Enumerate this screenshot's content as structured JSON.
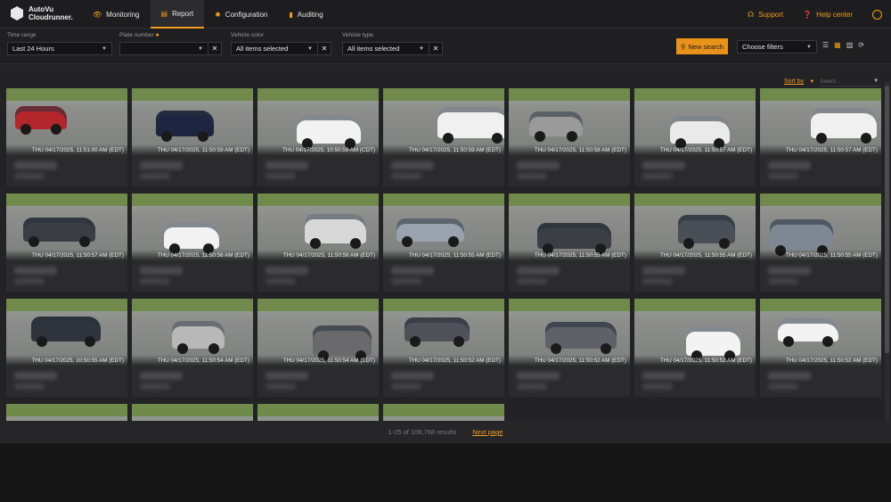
{
  "app": {
    "logo_line1": "AutoVu",
    "logo_line2": "Cloudrunner."
  },
  "nav": {
    "items": [
      {
        "label": "Monitoring",
        "icon": "binoculars-icon",
        "glyph": "👁"
      },
      {
        "label": "Report",
        "icon": "report-icon",
        "glyph": "▤",
        "active": true
      },
      {
        "label": "Configuration",
        "icon": "gear-icon",
        "glyph": "✹"
      },
      {
        "label": "Auditing",
        "icon": "document-icon",
        "glyph": "▮"
      }
    ],
    "support": "Support",
    "help": "Help center"
  },
  "filters": {
    "time_range": {
      "label": "Time range",
      "value": "Last 24 Hours"
    },
    "plate_number": {
      "label": "Plate number",
      "value": ""
    },
    "vehicle_color": {
      "label": "Vehicle color",
      "value": "All items selected"
    },
    "vehicle_type": {
      "label": "Vehicle type",
      "value": "All items selected"
    },
    "new_search": "New search",
    "choose_filters": "Choose filters"
  },
  "sort": {
    "label": "Sort by",
    "placeholder": "Select..."
  },
  "results": {
    "cards": [
      {
        "timestamp": "THU 04/17/2025, 11:51:00 AM (EDT)",
        "color": "#b3262b"
      },
      {
        "timestamp": "THU 04/17/2025, 11:50:59 AM (EDT)",
        "color": "#1d2540"
      },
      {
        "timestamp": "THU 04/17/2025, 10:50:59 AM (CDT)",
        "color": "#f2f2f2"
      },
      {
        "timestamp": "THU 04/17/2025, 11:50:59 AM (EDT)",
        "color": "#f0f0f0"
      },
      {
        "timestamp": "THU 04/17/2025, 11:50:58 AM (EDT)",
        "color": "#9a9a9a"
      },
      {
        "timestamp": "THU 04/17/2025, 11:50:57 AM (EDT)",
        "color": "#eaeaea"
      },
      {
        "timestamp": "THU 04/17/2025, 11:50:57 AM (EDT)",
        "color": "#f0f0f0"
      },
      {
        "timestamp": "THU 04/17/2025, 11:50:57 AM (EDT)",
        "color": "#3a3d44"
      },
      {
        "timestamp": "THU 04/17/2025, 11:50:56 AM (EDT)",
        "color": "#f2f2f2"
      },
      {
        "timestamp": "THU 04/17/2025, 11:50:56 AM (EDT)",
        "color": "#d8d8d8"
      },
      {
        "timestamp": "THU 04/17/2025, 11:50:55 AM (EDT)",
        "color": "#9aa3ad"
      },
      {
        "timestamp": "THU 04/17/2025, 11:50:55 AM (EDT)",
        "color": "#3b3e44"
      },
      {
        "timestamp": "THU 04/17/2025, 11:50:55 AM (EDT)",
        "color": "#4a4e56"
      },
      {
        "timestamp": "THU 04/17/2025, 11:50:55 AM (EDT)",
        "color": "#7e8894"
      },
      {
        "timestamp": "THU 04/17/2025, 10:50:55 AM (EDT)",
        "color": "#2e333c"
      },
      {
        "timestamp": "THU 04/17/2025, 11:50:54 AM (EDT)",
        "color": "#b8b8b8"
      },
      {
        "timestamp": "THU 04/17/2025, 11:50:54 AM (EDT)",
        "color": "#6a6a6d"
      },
      {
        "timestamp": "THU 04/17/2025, 11:50:52 AM (EDT)",
        "color": "#50525a"
      },
      {
        "timestamp": "THU 04/17/2025, 11:50:52 AM (EDT)",
        "color": "#5e6168"
      },
      {
        "timestamp": "THU 04/17/2025, 11:50:52 AM (EDT)",
        "color": "#f3f3f3"
      },
      {
        "timestamp": "THU 04/17/2025, 11:50:52 AM (EDT)",
        "color": "#f3f3f3"
      },
      {
        "timestamp": "",
        "color": "#e8e8e8"
      },
      {
        "timestamp": "",
        "color": "#8a8a8a"
      },
      {
        "timestamp": "",
        "color": "#3f4550"
      },
      {
        "timestamp": "",
        "color": "#dcdcdc"
      }
    ]
  },
  "pager": {
    "count": "1-25 of 109,768 results",
    "next": "Next page"
  }
}
